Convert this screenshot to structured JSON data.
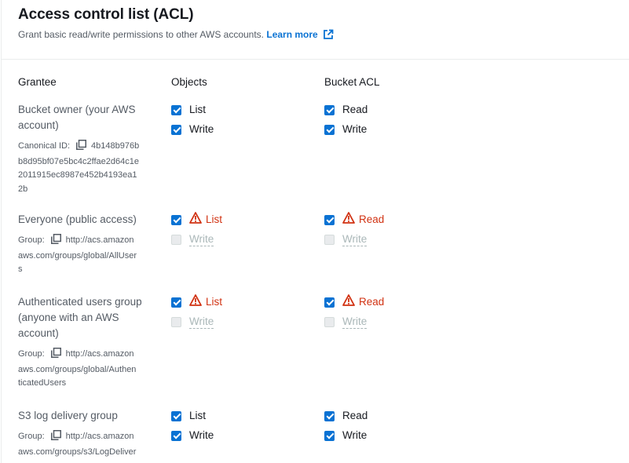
{
  "header": {
    "title": "Access control list (ACL)",
    "description": "Grant basic read/write permissions to other AWS accounts.",
    "learn_more": "Learn more"
  },
  "columns": {
    "grantee": "Grantee",
    "objects": "Objects",
    "bucket_acl": "Bucket ACL"
  },
  "rows": [
    {
      "name_lines": [
        "Bucket owner (your AWS",
        "account)"
      ],
      "meta_label": "Canonical ID:",
      "meta_lines": [
        "4b148b976b",
        "b8d95bf07e5bc4c2ffae2d64c1e",
        "2011915ec8987e452b4193ea1",
        "2b"
      ],
      "objects": [
        {
          "label": "List",
          "checked": true,
          "warning": false,
          "disabled": false
        },
        {
          "label": "Write",
          "checked": true,
          "warning": false,
          "disabled": false
        }
      ],
      "bucket_acl": [
        {
          "label": "Read",
          "checked": true,
          "warning": false,
          "disabled": false
        },
        {
          "label": "Write",
          "checked": true,
          "warning": false,
          "disabled": false
        }
      ]
    },
    {
      "name_lines": [
        "Everyone (public access)"
      ],
      "meta_label": "Group:",
      "meta_lines": [
        "http://acs.amazon",
        "aws.com/groups/global/AllUser",
        "s"
      ],
      "objects": [
        {
          "label": "List",
          "checked": true,
          "warning": true,
          "disabled": false
        },
        {
          "label": "Write",
          "checked": false,
          "warning": false,
          "disabled": true
        }
      ],
      "bucket_acl": [
        {
          "label": "Read",
          "checked": true,
          "warning": true,
          "disabled": false
        },
        {
          "label": "Write",
          "checked": false,
          "warning": false,
          "disabled": true
        }
      ]
    },
    {
      "name_lines": [
        "Authenticated users group",
        "(anyone with an AWS",
        "account)"
      ],
      "meta_label": "Group:",
      "meta_lines": [
        "http://acs.amazon",
        "aws.com/groups/global/Authen",
        "ticatedUsers"
      ],
      "objects": [
        {
          "label": "List",
          "checked": true,
          "warning": true,
          "disabled": false
        },
        {
          "label": "Write",
          "checked": false,
          "warning": false,
          "disabled": true
        }
      ],
      "bucket_acl": [
        {
          "label": "Read",
          "checked": true,
          "warning": true,
          "disabled": false
        },
        {
          "label": "Write",
          "checked": false,
          "warning": false,
          "disabled": true
        }
      ]
    },
    {
      "name_lines": [
        "S3 log delivery group"
      ],
      "meta_label": "Group:",
      "meta_lines": [
        "http://acs.amazon",
        "aws.com/groups/s3/LogDeliver"
      ],
      "objects": [
        {
          "label": "List",
          "checked": true,
          "warning": false,
          "disabled": false
        },
        {
          "label": "Write",
          "checked": true,
          "warning": false,
          "disabled": false
        }
      ],
      "bucket_acl": [
        {
          "label": "Read",
          "checked": true,
          "warning": false,
          "disabled": false
        },
        {
          "label": "Write",
          "checked": true,
          "warning": false,
          "disabled": false
        }
      ]
    }
  ],
  "colors": {
    "accent": "#0972d3",
    "warning": "#d13212",
    "disabled": "#aab7b8"
  },
  "icons": {
    "external_link": "external-link-icon",
    "copy": "copy-icon",
    "warning": "warning-icon"
  }
}
